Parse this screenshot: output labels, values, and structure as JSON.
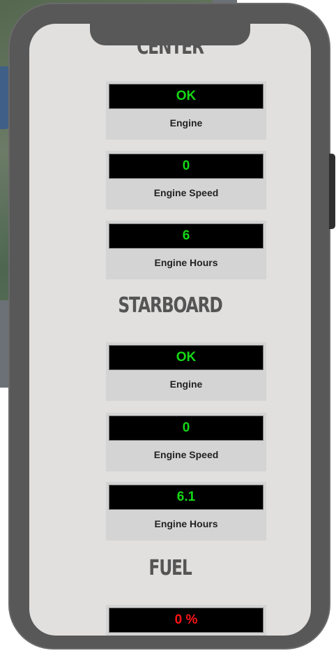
{
  "sections": [
    {
      "title": "CENTER",
      "metrics": [
        {
          "value": "OK",
          "label": "Engine"
        },
        {
          "value": "0",
          "label": "Engine Speed"
        },
        {
          "value": "6",
          "label": "Engine Hours"
        }
      ]
    },
    {
      "title": "STARBOARD",
      "metrics": [
        {
          "value": "OK",
          "label": "Engine"
        },
        {
          "value": "0",
          "label": "Engine Speed"
        },
        {
          "value": "6.1",
          "label": "Engine Hours"
        }
      ]
    },
    {
      "title": "FUEL",
      "metrics": [
        {
          "value": "0 %",
          "label": ""
        }
      ]
    }
  ],
  "colors": {
    "ok_value": "#14d814",
    "alert_value": "#ff1414"
  }
}
